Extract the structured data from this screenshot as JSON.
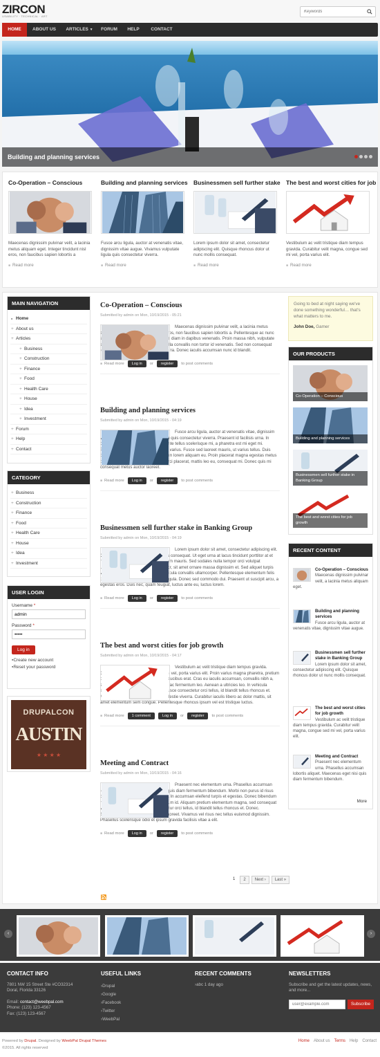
{
  "site": {
    "logo": "ZIRCON",
    "tagline": "USABILITY · TECHNICAL · ART",
    "search_placeholder": "Keywords"
  },
  "nav": [
    "HOME",
    "ABOUT US",
    "ARTICLES",
    "FORUM",
    "HELP",
    "CONTACT"
  ],
  "slider": {
    "caption": "Building and planning services",
    "active_dot": 1
  },
  "featured": [
    {
      "title": "Co-Operation – Conscious",
      "body": "Maecenas dignissim pulvinar velit, a lacinia metus aliquam eget. Integer tincidunt nisl eros, non faucibus sapien lobortis a",
      "readmore": "Read more"
    },
    {
      "title": "Building and planning services",
      "body": "Fusce arcu ligula, auctor at venenatis vitae, dignissim vitae augue. Vivamus vulputate ligula quis consectetur viverra.",
      "readmore": "Read more"
    },
    {
      "title": "Businessmen sell further stake",
      "body": "Lorem ipsum dolor sit amet, consectetur adipiscing elit. Quisque rhoncus dolor ut nunc mollis consequat.",
      "readmore": "Read more"
    },
    {
      "title": "The best and worst cities for job",
      "body": "Vestibulum ac velit tristique diam tempus gravida. Curabitur velit magna, congue sed mi vel, porta varius elit.",
      "readmore": "Read more"
    }
  ],
  "main_nav": {
    "title": "MAIN NAVIGATION",
    "items": [
      "Home",
      "About us",
      "Articles",
      "Business",
      "Construction",
      "Finance",
      "Food",
      "Health Care",
      "House",
      "Idea",
      "Investment",
      "Forum",
      "Help",
      "Contact"
    ]
  },
  "category": {
    "title": "CATEGORY",
    "items": [
      "Business",
      "Construction",
      "Finance",
      "Food",
      "Health Care",
      "House",
      "Idea",
      "Investment"
    ]
  },
  "login": {
    "title": "USER LOGIN",
    "username_label": "Username",
    "username_value": "admin",
    "password_label": "Password",
    "password_value": "•••••",
    "button": "Log in",
    "links": [
      "Create new account",
      "Reset your password"
    ]
  },
  "ad": {
    "line1": "DRUPALCON",
    "line2": "AUSTIN"
  },
  "articles": [
    {
      "title": "Co-Operation – Conscious",
      "meta": "Submitted by admin on Mon, 10/19/2015 - 05:21",
      "body": "Maecenas dignissim pulvinar velit, a lacinia metus aliquam eget. Integer tincidunt nisl eros, non faucibus sapien lobortis a. Pellentesque ac nunc eu quam vulputate porta. Proin mattis diam in dapibus venenatis. Proin massa nibh, vulputate eu vehicula id, convallis ac tellus. Nulla convallis non tortor id venenatis. Sed non consequat lorem. Duis sodales ullamcorper viverra. Donec iaculis accumsan nunc id blandit.",
      "comments": ""
    },
    {
      "title": "Building and planning services",
      "meta": "Submitted by admin on Mon, 10/19/2015 - 04:19",
      "body": "Fusce arcu ligula, auctor at venenatis vitae, dignissim vitae augue. Vivamus vulputate ligula quis consectetur viverra. Praesent id facilisis urna. In dictum, justo id fringilla consequat, ante tellus scelerisque mi, a pharetra est mi eget mi. Phasellus quis tortor in tellus lobortis varius. Fusce sed laoreet mauris, ut varius tellus. Duis dapibus dignissim ligula, quis interdum lorem aliquam eu. Proin placerat magna egestas metus porttitor pharetra. Pellentesque vel orci placerat, mattis leo eu, consequat mi. Donec quis mi consequat metus auctor laoreet.",
      "comments": ""
    },
    {
      "title": "Businessmen sell further stake in Banking Group",
      "meta": "Submitted by admin on Mon, 10/19/2015 - 04:19",
      "body": "Lorem ipsum dolor sit amet, consectetur adipiscing elit. Quisque rhoncus dolor ut nunc mollis consequat. Ut eget urna at lacus tincidunt porttitor at et metus. In a congue diam, vitae pretium mauris. Sed sodales nulla tempor orci volutpat ullamcorper. Etiam imperdiet dui tortor, sit amet ornare massa dignissim et. Sed aliquet turpis vitae hendrerit dignissim. Donec vehicula convallis ullamcorper. Pellentesque elementum felis tristique, auctor magna vel, lobortis ligula. Donec sed commodo dui. Praesent ut suscipit arcu, a egestas eros. Duis nec, quam feugiat, luctus ante eu, luctus lorem.",
      "comments": ""
    },
    {
      "title": "The best and worst cities for job growth",
      "meta": "Submitted by admin on Mon, 10/19/2015 - 04:17",
      "body": "Vestibulum ac velit tristique diam tempus gravida. Curabitur velit magna, congue sed mi vel, porta varius elit. Proin varius magna pharetra, pretium odio at, lacinia augue. Aliquam non faucibus erat. Cras eu iaculis accumsan, convallis nibh a, euismod elit. Nulla ac accumsan est, ac fermentum leo. Aenean a ultricies leo. In vehicula semper velit, vitae venenatis ante. Fusce consectetur orci tellus, id blandit tellus rhoncus et. Maecenas semper velit nec risus molestie viverra. Curabitur iaculis libero ac dolor mattis, sit amet elementum sem congue. Pellentesque rhoncus ipsum vel est tristique luctus.",
      "comments": "1 comment"
    },
    {
      "title": "Meeting and Contract",
      "meta": "Submitted by admin on Mon, 10/19/2015 - 04:16",
      "body": "Praesent nec elementum urna. Phasellus accumsan lobortis aliquet. Maecenas eget nisi quis diam fermentum bibendum. Morbi non purus id risus commodo scelerisque nec vel ipsum. In accumsan eleifend turpis et egestas. Donec bibendum massa massa, ac sodales purus rutrum id. Aliquam pretium elementum magna, sed consequat velit venenatis vitae. Fusce consectetur orci tellus, id blandit tellus rhoncus et. Donec. Suspendisse tincidunt in ante vitae laoreet. Vivamus vel risus nec tellus euismod dignissim. Phasellus scelerisque odio et ipsum gravida facilisis vitae a elit.",
      "comments": ""
    }
  ],
  "article_links": {
    "readmore": "Read more",
    "login": "Log in",
    "or": "or",
    "register": "register",
    "post": "to post comments"
  },
  "pager": [
    "1",
    "2",
    "Next ›",
    "Last »"
  ],
  "quote": {
    "text": "Going to bed at night saying we've done something wonderful… that's what matters to me.",
    "author": "John Doe,",
    "role": "Gamer"
  },
  "products": {
    "title": "OUR PRODUCTS",
    "items": [
      "Co-Operation – Conscious",
      "Building and planning services",
      "Businessmen sell further stake in Banking Group",
      "The best and worst cities for job growth"
    ]
  },
  "recent": {
    "title": "RECENT CONTENT",
    "items": [
      {
        "title": "Co-Operation – Conscious",
        "body": "Maecenas dignissim pulvinar velit, a lacinia metus aliquam eget."
      },
      {
        "title": "Building and planning services",
        "body": "Fusce arcu ligula, auctor at venenatis vitae, dignissim vitae augue."
      },
      {
        "title": "Businessmen sell further stake in Banking Group",
        "body": "Lorem ipsum dolor sit amet, consectetur adipiscing elit. Quisque rhoncus dolor ut nunc mollis consequat."
      },
      {
        "title": "The best and worst cities for job growth",
        "body": "Vestibulum ac velit tristique diam tempus gravida. Curabitur velit magna, congue sed mi vel, porta varius elit."
      },
      {
        "title": "Meeting and Contract",
        "body": "Praesent nec elementum urna. Phasellus accumsan lobortis aliquet. Maecenas eget nisi quis diam fermentum bibendum."
      }
    ],
    "more": "More"
  },
  "footer": {
    "contact_title": "CONTACT INFO",
    "address1": "7801 NW 15 Street Ste #CO32314",
    "address2": "Doral, Florida 33126",
    "email_label": "Email:",
    "email": "contact@weebpal.com",
    "phone": "Phone: (123) 123-4567",
    "fax": "Fax: (123) 123-4567",
    "links_title": "USEFUL LINKS",
    "links": [
      "Drupal",
      "Google",
      "Facebook",
      "Twitter",
      "WeebPal"
    ],
    "comments_title": "RECENT COMMENTS",
    "comment": "abc 1 day ago",
    "news_title": "NEWSLETTERS",
    "news_text": "Subscribe and get the latest updates, news, and more...",
    "news_placeholder": "user@example.com",
    "news_button": "Subscribe"
  },
  "bottom": {
    "powered": "Powered by",
    "drupal": "Drupal.",
    "designed": "Designed by",
    "weebpal": "WeebPal Drupal Themes",
    "copyright": "©2015. All rights reserved",
    "nav": [
      "Home",
      "About us",
      "Terms",
      "Help",
      "Contact"
    ]
  },
  "colors": {
    "accent": "#c4261d",
    "dark": "#2c2c2c",
    "footer": "#3b3b3b"
  },
  "icons": [
    "search-icon",
    "rss-icon",
    "chevron-left-icon",
    "chevron-right-icon",
    "caret-down-icon"
  ]
}
